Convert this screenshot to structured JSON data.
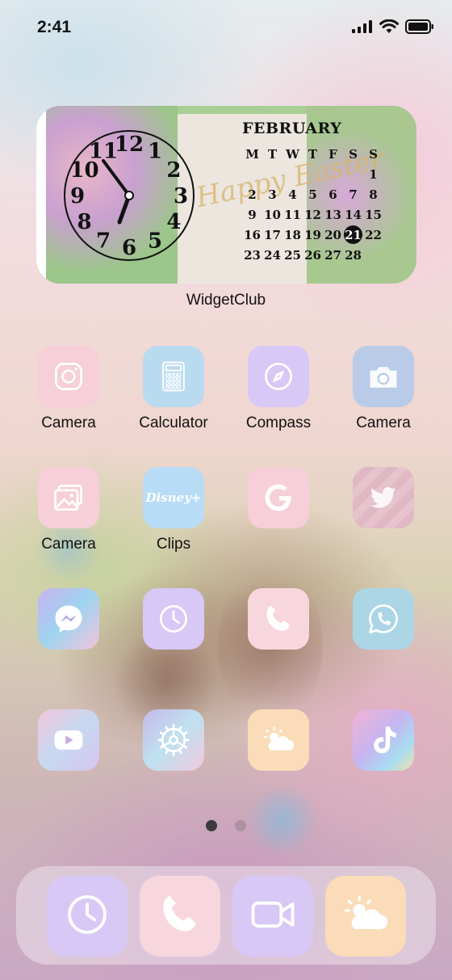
{
  "status_bar": {
    "time": "2:41"
  },
  "widget": {
    "label": "WidgetClub",
    "happy_text": "Happy Easter",
    "clock_numbers": [
      "12",
      "1",
      "2",
      "3",
      "4",
      "5",
      "6",
      "7",
      "8",
      "9",
      "10",
      "11"
    ],
    "calendar": {
      "month": "FEBRUARY",
      "weekdays": [
        "M",
        "T",
        "W",
        "T",
        "F",
        "S",
        "S"
      ],
      "days": [
        "",
        "",
        "",
        "",
        "",
        "",
        "1",
        "2",
        "3",
        "4",
        "5",
        "6",
        "7",
        "8",
        "9",
        "10",
        "11",
        "12",
        "13",
        "14",
        "15",
        "16",
        "17",
        "18",
        "19",
        "20",
        "21",
        "22",
        "23",
        "24",
        "25",
        "26",
        "27",
        "28",
        ""
      ],
      "today": "21"
    }
  },
  "apps": [
    {
      "label": "Camera",
      "icon": "instagram-icon",
      "color": "#f6cfd9"
    },
    {
      "label": "Calculator",
      "icon": "calculator-icon",
      "color": "#b9dbf0"
    },
    {
      "label": "Compass",
      "icon": "compass-icon",
      "color": "#d8c8f5"
    },
    {
      "label": "Camera",
      "icon": "camera-icon",
      "color": "#b9cbe6"
    },
    {
      "label": "Camera",
      "icon": "photos-icon",
      "color": "#f6cfd9"
    },
    {
      "label": "Clips",
      "icon": "disney-plus-icon",
      "color": "#b9dcf6"
    },
    {
      "label": "",
      "icon": "google-icon",
      "color": "#f6cfd9"
    },
    {
      "label": "",
      "icon": "twitter-icon",
      "color": "#e5c2cc"
    },
    {
      "label": "",
      "icon": "messenger-icon",
      "color": "#dccff0"
    },
    {
      "label": "",
      "icon": "clock-icon",
      "color": "#d8c8f5"
    },
    {
      "label": "",
      "icon": "phone-icon",
      "color": "#f8d6de"
    },
    {
      "label": "",
      "icon": "whatsapp-icon",
      "color": "#acd6e6"
    },
    {
      "label": "",
      "icon": "youtube-icon",
      "color": "#e7d4ec"
    },
    {
      "label": "",
      "icon": "settings-icon",
      "color": "#d7cbe9"
    },
    {
      "label": "",
      "icon": "weather-icon",
      "color": "#fbdcb8"
    },
    {
      "label": "",
      "icon": "tiktok-icon",
      "color": "#e8c2e6"
    }
  ],
  "disney_text": "Disney+",
  "page_indicator": {
    "count": 2,
    "active": 0
  },
  "dock": [
    {
      "icon": "clock-icon",
      "color": "#d8c8f5"
    },
    {
      "icon": "phone-icon",
      "color": "#f8d6de"
    },
    {
      "icon": "video-icon",
      "color": "#d8c8f5"
    },
    {
      "icon": "weather-icon",
      "color": "#fbdcb8"
    }
  ]
}
